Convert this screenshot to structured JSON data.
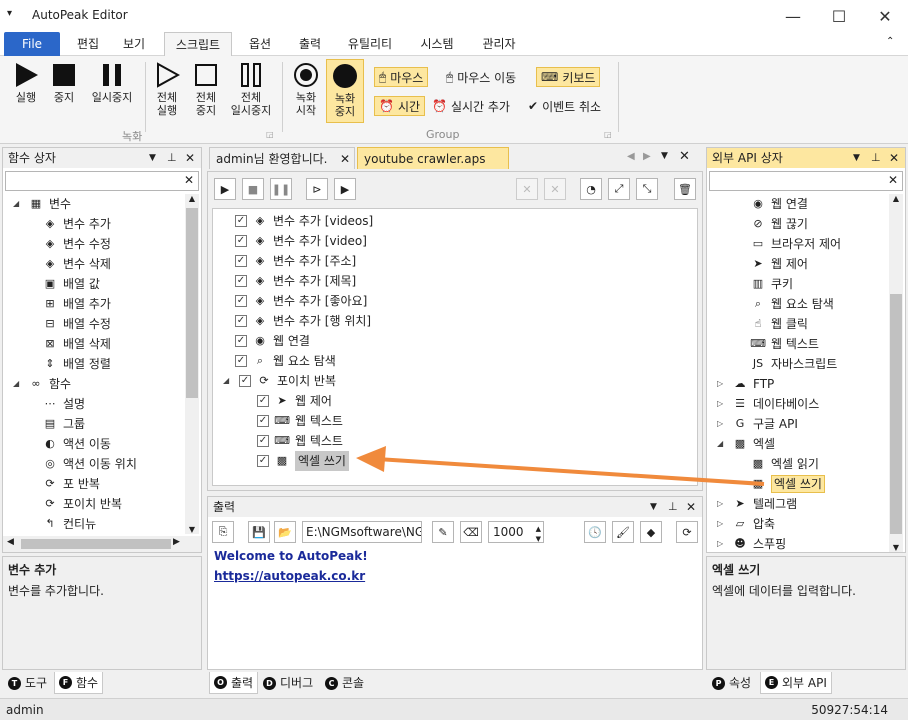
{
  "window": {
    "title": "AutoPeak Editor",
    "menu_glyph": "▾",
    "min": "—",
    "max": "☐",
    "close": "✕"
  },
  "menu_tabs": [
    "File",
    "편집",
    "보기",
    "스크립트",
    "옵션",
    "출력",
    "유틸리티",
    "시스템",
    "관리자"
  ],
  "ribbon": {
    "run": "실행",
    "stop": "중지",
    "pause": "일시중지",
    "run_all_1": "전체",
    "run_all_2": "실행",
    "stop_all_1": "전체",
    "stop_all_2": "중지",
    "pause_all_1": "전체",
    "pause_all_2": "일시중지",
    "group_record": "녹화",
    "record_start_1": "녹화",
    "record_start_2": "시작",
    "record_stop_1": "녹화",
    "record_stop_2": "중지",
    "mouse": "마우스",
    "mouse_move": "마우스 이동",
    "keyboard": "키보드",
    "time": "시간",
    "realtime_add": "실시간 추가",
    "cancel_event": "이벤트 취소",
    "group_label": "Group"
  },
  "left_panel": {
    "title": "함수 상자",
    "items": [
      {
        "label": "변수",
        "icon": "grid-icon",
        "type": "group"
      },
      {
        "label": "변수 추가",
        "icon": "cube-icon"
      },
      {
        "label": "변수 수정",
        "icon": "cube-icon"
      },
      {
        "label": "변수 삭제",
        "icon": "cube-icon"
      },
      {
        "label": "배열 값",
        "icon": "array-icon"
      },
      {
        "label": "배열 추가",
        "icon": "array-add-icon"
      },
      {
        "label": "배열 수정",
        "icon": "array-edit-icon"
      },
      {
        "label": "배열 삭제",
        "icon": "array-delete-icon"
      },
      {
        "label": "배열 정렬",
        "icon": "sort-icon"
      },
      {
        "label": "함수",
        "icon": "infinity-icon",
        "type": "group"
      },
      {
        "label": "설명",
        "icon": "comment-icon"
      },
      {
        "label": "그룹",
        "icon": "group-icon"
      },
      {
        "label": "액션 이동",
        "icon": "action-move-icon"
      },
      {
        "label": "액션 이동 위치",
        "icon": "target-icon"
      },
      {
        "label": "포 반복",
        "icon": "loop-icon"
      },
      {
        "label": "포이치 반복",
        "icon": "loop-icon"
      },
      {
        "label": "컨티뉴",
        "icon": "continue-icon"
      }
    ],
    "desc_title": "변수 추가",
    "desc_text": "변수를 추가합니다.",
    "tabs": [
      {
        "dot": "T",
        "label": "도구"
      },
      {
        "dot": "F",
        "label": "함수"
      }
    ]
  },
  "doc_tabs": [
    {
      "label": "admin님 환영합니다."
    },
    {
      "label": "youtube crawler.aps"
    }
  ],
  "script_items": [
    {
      "label": "변수 추가 [videos]",
      "icon": "cube-icon",
      "indent": 0
    },
    {
      "label": "변수 추가 [video]",
      "icon": "cube-icon",
      "indent": 0
    },
    {
      "label": "변수 추가 [주소]",
      "icon": "cube-icon",
      "indent": 0
    },
    {
      "label": "변수 추가 [제목]",
      "icon": "cube-icon",
      "indent": 0
    },
    {
      "label": "변수 추가 [좋아요]",
      "icon": "cube-icon",
      "indent": 0
    },
    {
      "label": "변수 추가 [행 위치]",
      "icon": "cube-icon",
      "indent": 0
    },
    {
      "label": "웹 연결",
      "icon": "chrome-icon",
      "indent": 0
    },
    {
      "label": "웹 요소 탐색",
      "icon": "magnify-icon",
      "indent": 0
    },
    {
      "label": "포이치 반복",
      "icon": "loop-icon",
      "indent": 0,
      "expander": true
    },
    {
      "label": "웹 제어",
      "icon": "navigation-icon",
      "indent": 1
    },
    {
      "label": "웹 텍스트",
      "icon": "keyboard-icon",
      "indent": 1
    },
    {
      "label": "웹 텍스트",
      "icon": "keyboard-icon",
      "indent": 1
    },
    {
      "label": "엑셀 쓰기",
      "icon": "excel-icon",
      "indent": 1,
      "selected": true
    }
  ],
  "output": {
    "title": "출력",
    "path": "E:\\NGMsoftware\\NG",
    "number": "1000",
    "line1": "Welcome to AutoPeak!",
    "line2": "https://autopeak.co.kr",
    "tabs": [
      {
        "dot": "O",
        "label": "출력"
      },
      {
        "dot": "D",
        "label": "디버그"
      },
      {
        "dot": "C",
        "label": "콘솔"
      }
    ]
  },
  "right_panel": {
    "title": "외부 API 상자",
    "items": [
      {
        "label": "웹 연결",
        "icon": "chrome-icon",
        "indent": 1
      },
      {
        "label": "웹 끊기",
        "icon": "disconnect-icon",
        "indent": 1
      },
      {
        "label": "브라우저 제어",
        "icon": "browser-icon",
        "indent": 1
      },
      {
        "label": "웹 제어",
        "icon": "navigation-icon",
        "indent": 1
      },
      {
        "label": "쿠키",
        "icon": "chart-icon",
        "indent": 1
      },
      {
        "label": "웹 요소 탐색",
        "icon": "magnify-icon",
        "indent": 1
      },
      {
        "label": "웹 클릭",
        "icon": "click-icon",
        "indent": 1
      },
      {
        "label": "웹 텍스트",
        "icon": "keyboard-icon",
        "indent": 1
      },
      {
        "label": "자바스크립트",
        "icon": "js-icon",
        "indent": 1
      },
      {
        "label": "FTP",
        "icon": "cloud-icon",
        "indent": 0,
        "expander": "right"
      },
      {
        "label": "데이타베이스",
        "icon": "database-icon",
        "indent": 0,
        "expander": "right"
      },
      {
        "label": "구글 API",
        "icon": "google-icon",
        "indent": 0,
        "expander": "right"
      },
      {
        "label": "엑셀",
        "icon": "excel-icon",
        "indent": 0,
        "expander": "down"
      },
      {
        "label": "엑셀 읽기",
        "icon": "excel-read-icon",
        "indent": 1
      },
      {
        "label": "엑셀 쓰기",
        "icon": "excel-icon",
        "indent": 1,
        "selected": true
      },
      {
        "label": "텔레그램",
        "icon": "telegram-icon",
        "indent": 0,
        "expander": "right"
      },
      {
        "label": "압축",
        "icon": "folder-icon",
        "indent": 0,
        "expander": "right"
      },
      {
        "label": "스푸핑",
        "icon": "mask-icon",
        "indent": 0,
        "expander": "right"
      }
    ],
    "desc_title": "엑셀 쓰기",
    "desc_text": "엑셀에 데이터를 입력합니다.",
    "tabs": [
      {
        "dot": "P",
        "label": "속성"
      },
      {
        "dot": "E",
        "label": "외부 API"
      }
    ]
  },
  "status": {
    "user": "admin",
    "time": "50927:54:14"
  },
  "colors": {
    "accent": "#2b67c9",
    "highlight": "#fde7a0",
    "arrow": "#f08a3c"
  }
}
